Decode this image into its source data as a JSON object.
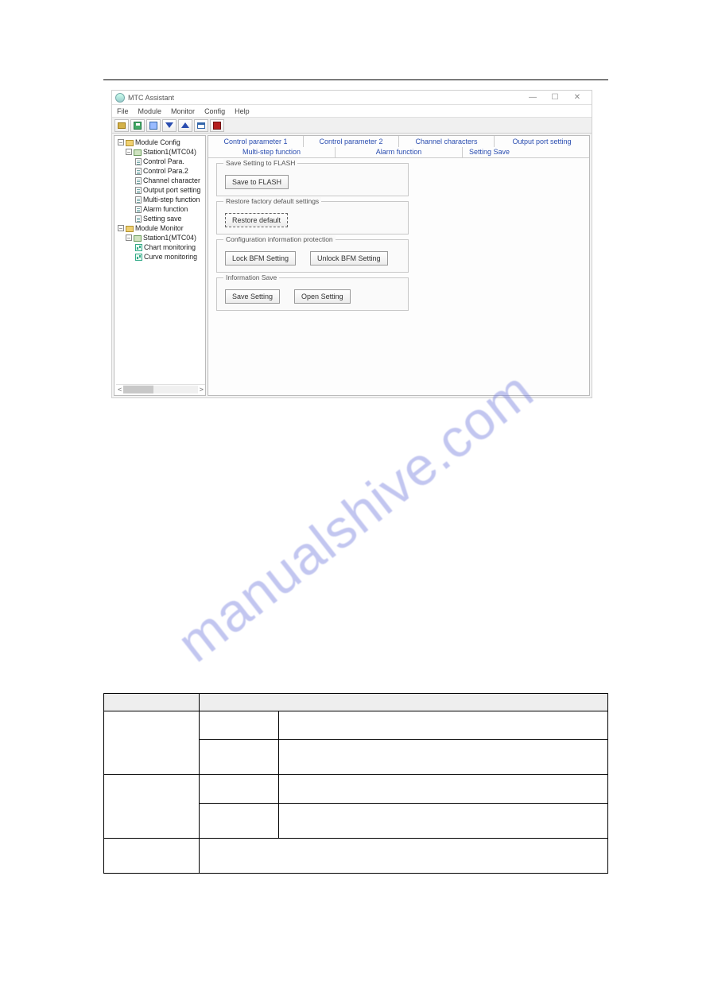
{
  "window": {
    "title": "MTC Assistant",
    "controls": {
      "min": "—",
      "max": "☐",
      "close": "✕"
    }
  },
  "menubar": {
    "items": [
      "File",
      "Module",
      "Monitor",
      "Config",
      "Help"
    ]
  },
  "toolbar": {
    "buttons": [
      {
        "name": "open-icon"
      },
      {
        "name": "save-icon"
      },
      {
        "name": "properties-icon"
      },
      {
        "name": "download-icon"
      },
      {
        "name": "upload-icon"
      },
      {
        "name": "window-icon"
      },
      {
        "name": "stop-icon"
      }
    ]
  },
  "tree": {
    "moduleConfig": {
      "label": "Module Config",
      "station": {
        "label": "Station1(MTC04)",
        "items": [
          "Control Para.",
          "Control Para.2",
          "Channel character",
          "Output port setting",
          "Multi-step function",
          "Alarm function",
          "Setting save"
        ]
      }
    },
    "moduleMonitor": {
      "label": "Module Monitor",
      "station": {
        "label": "Station1(MTC04)",
        "items": [
          "Chart monitoring",
          "Curve monitoring"
        ]
      }
    }
  },
  "scrollbar": {
    "left": "<",
    "right": ">"
  },
  "tabs": {
    "row1": [
      "Control parameter 1",
      "Control parameter 2",
      "Channel characters",
      "Output port setting"
    ],
    "row2": [
      "Multi-step function",
      "Alarm function",
      "Setting Save"
    ]
  },
  "groups": {
    "saveFlash": {
      "legend": "Save Setting to FLASH",
      "btn": "Save to FLASH"
    },
    "restore": {
      "legend": "Restore factory default settings",
      "btn": "Restore default"
    },
    "protect": {
      "legend": "Configuration information protection",
      "btn1": "Lock BFM Setting",
      "btn2": "Unlock BFM Setting"
    },
    "infoSave": {
      "legend": "Information Save",
      "btn1": "Save Setting",
      "btn2": "Open Setting"
    }
  },
  "watermark": "manualshive.com",
  "docTable": {
    "header": [
      "",
      ""
    ],
    "rows": [
      {
        "c1": "",
        "c2": "",
        "c3": ""
      },
      {
        "c2": "",
        "c3": ""
      },
      {
        "c1": "",
        "c2": "",
        "c3": ""
      },
      {
        "c2": "",
        "c3": ""
      },
      {
        "c1": "",
        "c23": ""
      }
    ]
  }
}
